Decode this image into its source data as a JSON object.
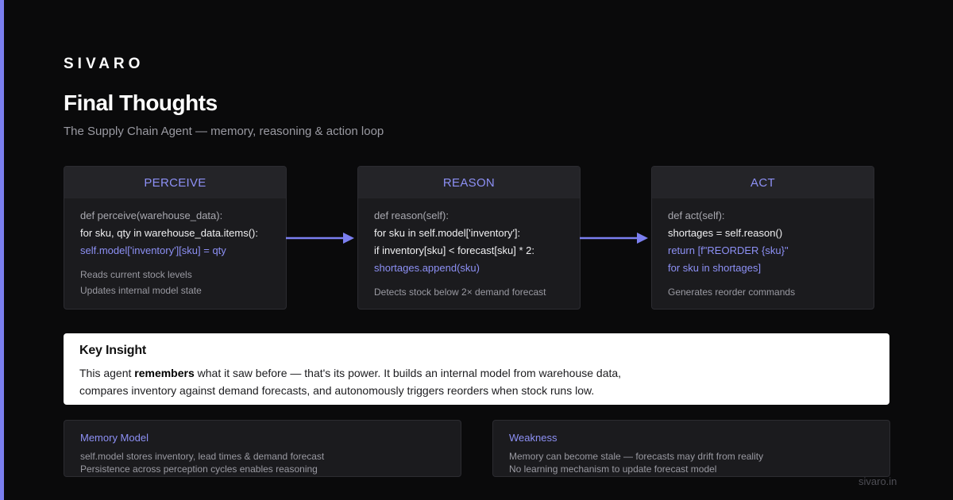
{
  "brand": "SIVARO",
  "title": "Final Thoughts",
  "subtitle": "The Supply Chain Agent — memory, reasoning & action loop",
  "colors": {
    "accent": "#7b7ff0",
    "background": "#0a0a0b",
    "card": "#1b1b1e",
    "insight_bg": "#ffffff"
  },
  "stages": [
    {
      "title": "PERCEIVE",
      "code": [
        "def perceive(warehouse_data):",
        "for sku, qty in warehouse_data.items():",
        "self.model['inventory'][sku] = qty"
      ],
      "notes": [
        "Reads current stock levels",
        "Updates internal model state"
      ]
    },
    {
      "title": "REASON",
      "code": [
        "def reason(self):",
        "for sku in self.model['inventory']:",
        "if inventory[sku] < forecast[sku] * 2:",
        "shortages.append(sku)"
      ],
      "notes": [
        "Detects stock below 2× demand forecast"
      ]
    },
    {
      "title": "ACT",
      "code": [
        "def act(self):",
        "shortages = self.reason()",
        "return [f\"REORDER {sku}\"",
        "for sku in shortages]"
      ],
      "notes": [
        "Generates reorder commands"
      ]
    }
  ],
  "insight": {
    "title": "Key Insight",
    "line1_pre": "This agent ",
    "line1_bold": "remembers",
    "line1_post": " what it saw before — that's its power. It builds an internal model from warehouse data,",
    "line2": "compares inventory against demand forecasts, and autonomously triggers reorders when stock runs low."
  },
  "panels": [
    {
      "title": "Memory Model",
      "lines": [
        "self.model stores inventory, lead times & demand forecast",
        "Persistence across perception cycles enables reasoning"
      ]
    },
    {
      "title": "Weakness",
      "lines": [
        "Memory can become stale — forecasts may drift from reality",
        "No learning mechanism to update forecast model"
      ]
    }
  ],
  "footer": "sivaro.in"
}
